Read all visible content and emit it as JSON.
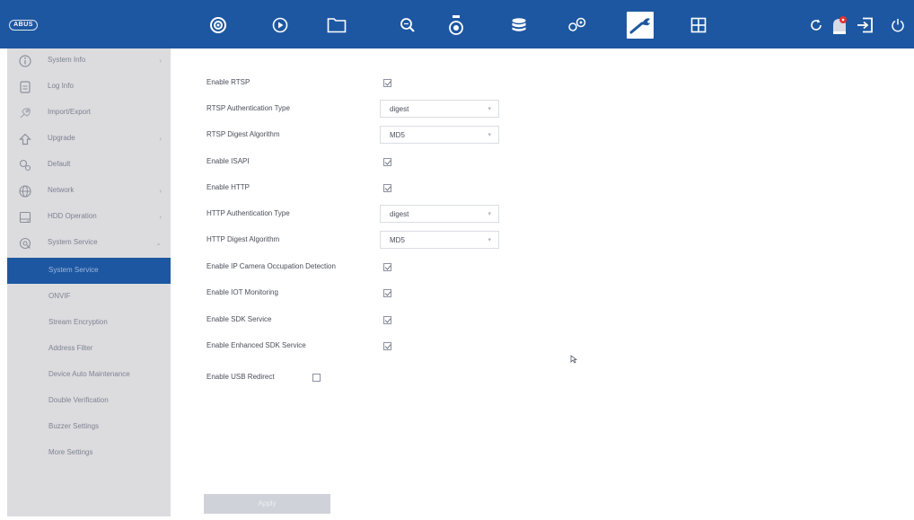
{
  "brand": {
    "logo_text": "ABUS"
  },
  "colors": {
    "primary": "#1d57a1",
    "sidebar_bg": "#dcdcdf",
    "active_sub": "#1d57a1"
  },
  "topbar": {
    "icons": [
      "live-view-icon",
      "playback-icon",
      "file-icon",
      "search-icon",
      "camera-icon",
      "storage-icon",
      "settings-icon",
      "maintenance-icon",
      "layout-icon"
    ],
    "active": "maintenance-icon",
    "right_icons": [
      "refresh-icon",
      "alarm-icon",
      "logout-icon",
      "power-icon"
    ]
  },
  "sidebar": {
    "items": [
      {
        "label": "System Info",
        "icon": "info-icon",
        "chevron": "›"
      },
      {
        "label": "Log Info",
        "icon": "document-icon",
        "chevron": ""
      },
      {
        "label": "Import/Export",
        "icon": "import-export-icon",
        "chevron": ""
      },
      {
        "label": "Upgrade",
        "icon": "upgrade-icon",
        "chevron": "›"
      },
      {
        "label": "Default",
        "icon": "default-icon",
        "chevron": ""
      },
      {
        "label": "Network",
        "icon": "network-icon",
        "chevron": "›"
      },
      {
        "label": "HDD Operation",
        "icon": "hdd-icon",
        "chevron": "›"
      },
      {
        "label": "System Service",
        "icon": "service-icon",
        "chevron": "⌄"
      }
    ],
    "sub_items": [
      {
        "label": "System Service",
        "active": true
      },
      {
        "label": "ONVIF",
        "active": false
      },
      {
        "label": "Stream Encryption",
        "active": false
      },
      {
        "label": "Address Filter",
        "active": false
      },
      {
        "label": "Device Auto Maintenance",
        "active": false
      },
      {
        "label": "Double Verification",
        "active": false
      },
      {
        "label": "Buzzer Settings",
        "active": false
      },
      {
        "label": "More Settings",
        "active": false
      }
    ]
  },
  "form": {
    "rows": [
      {
        "label": "Enable RTSP",
        "type": "checkbox",
        "checked": true
      },
      {
        "label": "RTSP Authentication Type",
        "type": "select",
        "value": "digest"
      },
      {
        "label": "RTSP Digest Algorithm",
        "type": "select",
        "value": "MD5"
      },
      {
        "label": "Enable ISAPI",
        "type": "checkbox",
        "checked": true
      },
      {
        "label": "Enable HTTP",
        "type": "checkbox",
        "checked": true
      },
      {
        "label": "HTTP Authentication Type",
        "type": "select",
        "value": "digest"
      },
      {
        "label": "HTTP Digest Algorithm",
        "type": "select",
        "value": "MD5"
      },
      {
        "label": "Enable IP Camera Occupation Detection",
        "type": "checkbox",
        "checked": true
      },
      {
        "label": "Enable IOT Monitoring",
        "type": "checkbox",
        "checked": true
      },
      {
        "label": "Enable SDK Service",
        "type": "checkbox",
        "checked": true
      },
      {
        "label": "Enable Enhanced SDK Service",
        "type": "checkbox",
        "checked": true
      },
      {
        "label": "Enable USB Redirect",
        "type": "checkbox",
        "checked": false
      }
    ],
    "apply_label": "Apply"
  }
}
